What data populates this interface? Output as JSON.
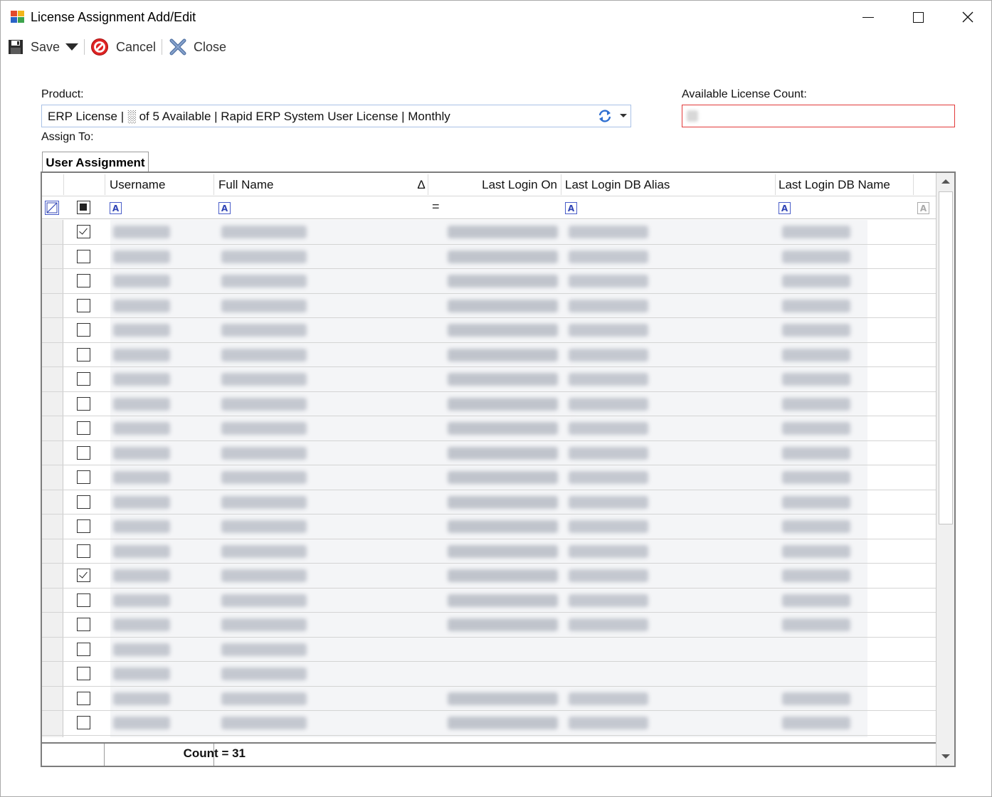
{
  "window": {
    "title": "License Assignment Add/Edit"
  },
  "toolbar": {
    "save_label": "Save",
    "cancel_label": "Cancel",
    "close_label": "Close"
  },
  "form": {
    "product_label": "Product:",
    "product_value": "ERP License | ░ of 5 Available | Rapid ERP System User License | Monthly",
    "available_count_label": "Available License Count:",
    "assign_to_label": "Assign To:"
  },
  "tab": {
    "label": "User Assignment"
  },
  "grid": {
    "columns": [
      "Username",
      "Full Name",
      "Last Login On",
      "Last Login DB Alias",
      "Last Login DB Name"
    ],
    "sort_indicator": "Δ",
    "filter_equals": "=",
    "filter_icon_glyph": "A",
    "rows": [
      {
        "checked": true,
        "login": true
      },
      {
        "checked": false,
        "login": true
      },
      {
        "checked": false,
        "login": true
      },
      {
        "checked": false,
        "login": true
      },
      {
        "checked": false,
        "login": true
      },
      {
        "checked": false,
        "login": true
      },
      {
        "checked": false,
        "login": true
      },
      {
        "checked": false,
        "login": true
      },
      {
        "checked": false,
        "login": true
      },
      {
        "checked": false,
        "login": true
      },
      {
        "checked": false,
        "login": true
      },
      {
        "checked": false,
        "login": true
      },
      {
        "checked": false,
        "login": true
      },
      {
        "checked": false,
        "login": true
      },
      {
        "checked": true,
        "login": true
      },
      {
        "checked": false,
        "login": true
      },
      {
        "checked": false,
        "login": true
      },
      {
        "checked": false,
        "login": false
      },
      {
        "checked": false,
        "login": false
      },
      {
        "checked": false,
        "login": true
      },
      {
        "checked": false,
        "login": true
      },
      {
        "checked": false,
        "login": true
      }
    ],
    "footer_count": "Count = 31"
  }
}
